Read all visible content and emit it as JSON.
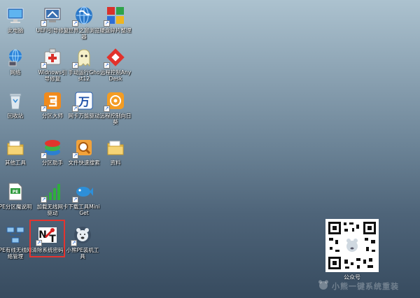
{
  "desktop": {
    "icons": [
      {
        "label": "此电脑",
        "icon": "this-pc-icon"
      },
      {
        "label": "UEFI引导修复",
        "icon": "uefi-repair-icon"
      },
      {
        "label": "世界之窗浏览器",
        "icon": "browser-globe-icon"
      },
      {
        "label": "硬盘碎片整理",
        "icon": "defrag-icon"
      },
      {
        "label": "网络",
        "icon": "network-icon"
      },
      {
        "label": "Widnows引导修复",
        "icon": "boot-repair-icon"
      },
      {
        "label": "手动运行Ghost12",
        "icon": "ghost-icon"
      },
      {
        "label": "远程控制AnyDesk",
        "icon": "anydesk-icon"
      },
      {
        "label": "回收站",
        "icon": "recycle-bin-icon"
      },
      {
        "label": "分区大师",
        "icon": "partition-master-icon"
      },
      {
        "label": "网卡万能驱动",
        "icon": "wan-driver-icon"
      },
      {
        "label": "远程控制向日葵",
        "icon": "sunflower-remote-icon"
      },
      {
        "label": "其他工具",
        "icon": "folder-icon"
      },
      {
        "label": "分区助手",
        "icon": "partition-assistant-icon"
      },
      {
        "label": "文件快速搜索",
        "icon": "file-search-icon"
      },
      {
        "label": "资料",
        "icon": "folder-icon"
      },
      {
        "label": "PE分区魔说明",
        "icon": "pe-document-icon"
      },
      {
        "label": "加载无线网卡驱动",
        "icon": "wifi-signal-icon"
      },
      {
        "label": "下载工具MiniGet",
        "icon": "miniget-fish-icon"
      },
      {
        "label": "PE有线无线网络管理",
        "icon": "network-manager-icon"
      },
      {
        "label": "清除系统密码",
        "icon": "nt-password-icon"
      },
      {
        "label": "小熊PE装机工具",
        "icon": "bear-installer-icon"
      }
    ]
  },
  "qr": {
    "label": "公众号"
  },
  "brand": {
    "text": "小熊一键系统重装"
  },
  "colors": {
    "selection": "#e3342f"
  }
}
